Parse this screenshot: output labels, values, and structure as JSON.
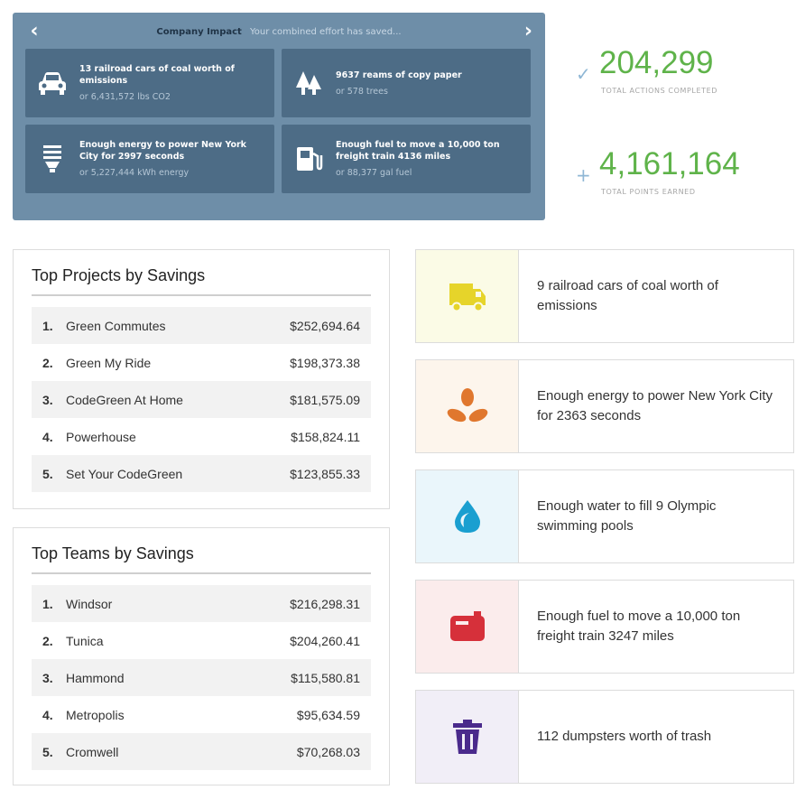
{
  "impact": {
    "title": "Company Impact",
    "subtitle": "Your combined effort has saved...",
    "cards": [
      {
        "icon": "car-icon",
        "main": "13 railroad cars of coal worth of emissions",
        "sub": "or 6,431,572 lbs CO2"
      },
      {
        "icon": "trees-icon",
        "main": "9637 reams of copy paper",
        "sub": "or 578 trees"
      },
      {
        "icon": "lightbulb-icon",
        "main": "Enough energy to power New York City for 2997 seconds",
        "sub": "or 5,227,444 kWh energy"
      },
      {
        "icon": "fuel-pump-icon",
        "main": "Enough fuel to move a 10,000 ton freight train 4136 miles",
        "sub": "or 88,377 gal fuel"
      }
    ]
  },
  "stats": {
    "actions": {
      "value": "204,299",
      "label": "TOTAL ACTIONS COMPLETED"
    },
    "points": {
      "value": "4,161,164",
      "label": "TOTAL POINTS EARNED"
    }
  },
  "projects": {
    "title": "Top Projects by Savings",
    "rows": [
      {
        "num": "1.",
        "name": "Green Commutes",
        "amount": "$252,694.64"
      },
      {
        "num": "2.",
        "name": "Green My Ride",
        "amount": "$198,373.38"
      },
      {
        "num": "3.",
        "name": "CodeGreen At Home",
        "amount": "$181,575.09"
      },
      {
        "num": "4.",
        "name": "Powerhouse",
        "amount": "$158,824.11"
      },
      {
        "num": "5.",
        "name": "Set Your CodeGreen",
        "amount": "$123,855.33"
      }
    ]
  },
  "teams": {
    "title": "Top Teams by Savings",
    "rows": [
      {
        "num": "1.",
        "name": "Windsor",
        "amount": "$216,298.31"
      },
      {
        "num": "2.",
        "name": "Tunica",
        "amount": "$204,260.41"
      },
      {
        "num": "3.",
        "name": "Hammond",
        "amount": "$115,580.81"
      },
      {
        "num": "4.",
        "name": "Metropolis",
        "amount": "$95,634.59"
      },
      {
        "num": "5.",
        "name": "Cromwell",
        "amount": "$70,268.03"
      }
    ]
  },
  "equivalents": [
    {
      "icon": "truck-icon",
      "color": "#e6d42a",
      "text": "9 railroad cars of coal worth of emissions"
    },
    {
      "icon": "fan-icon",
      "color": "#e0772e",
      "text": "Enough energy to power New York City for 2363 seconds"
    },
    {
      "icon": "water-drop-icon",
      "color": "#1a9fd0",
      "text": "Enough water to fill 9 Olympic swimming pools"
    },
    {
      "icon": "fuel-can-icon",
      "color": "#d6303a",
      "text": "Enough fuel to move a 10,000 ton freight train 3247 miles"
    },
    {
      "icon": "trash-icon",
      "color": "#4a2a8c",
      "text": "112 dumpsters worth of trash"
    }
  ],
  "colors": {
    "banner": "#6e8ea8",
    "card": "#4d6c86",
    "stat_value": "#5fb34a"
  }
}
